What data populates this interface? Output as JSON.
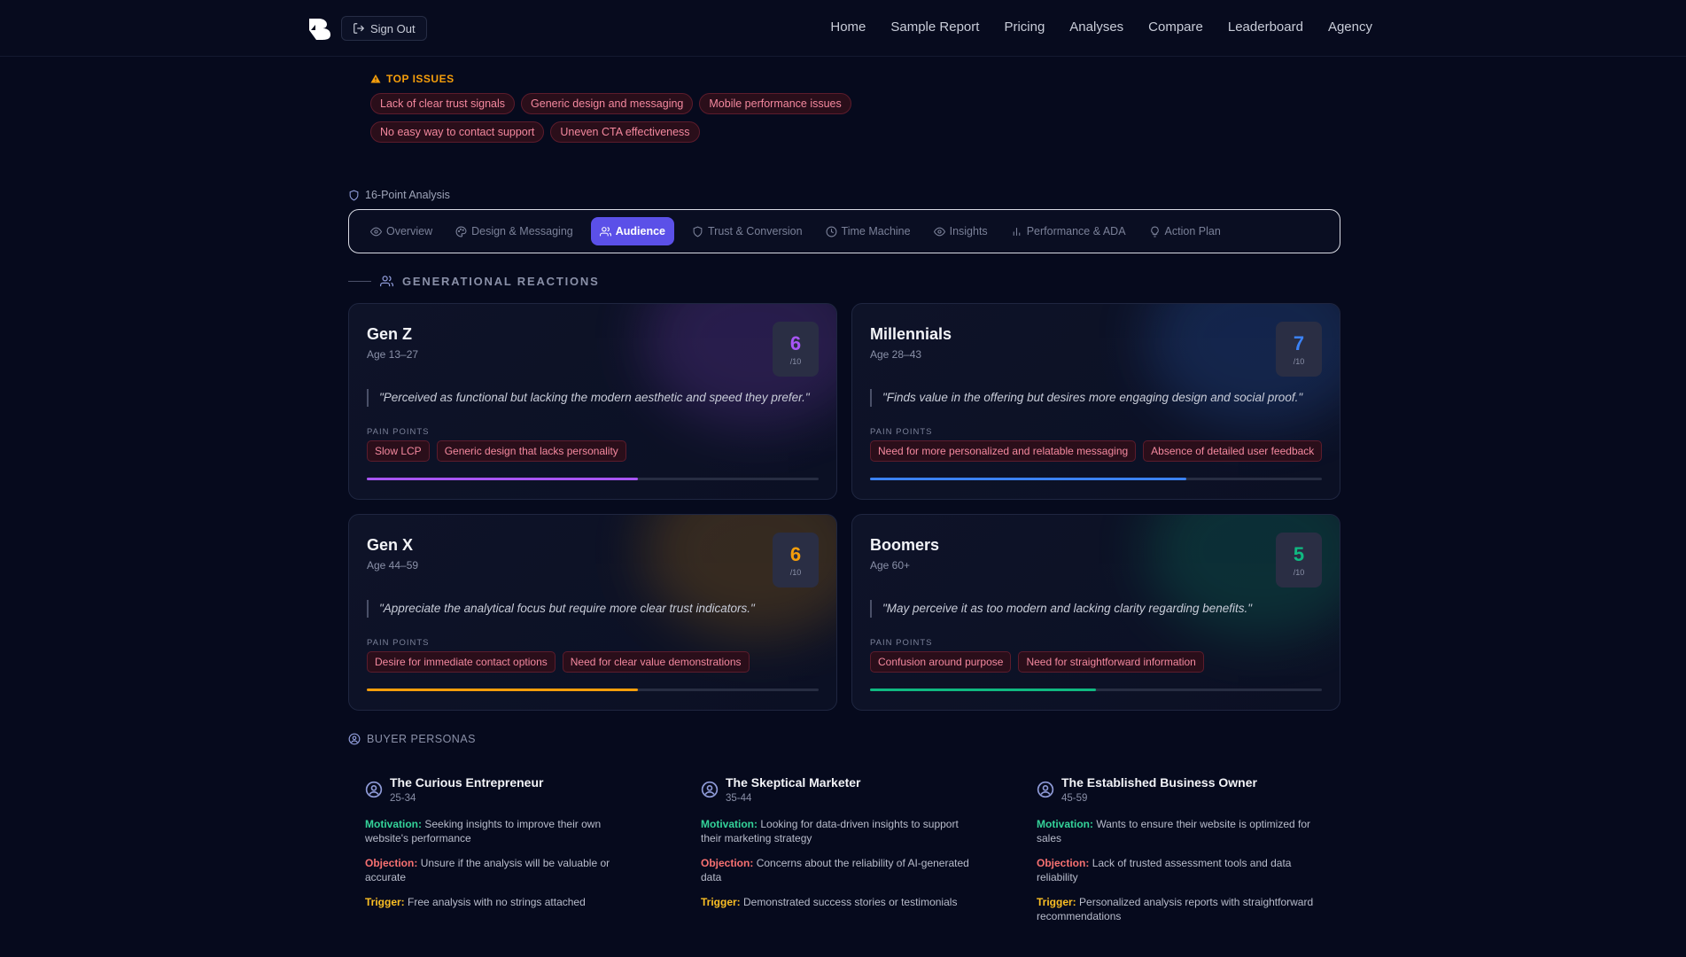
{
  "nav": {
    "signout_label": "Sign Out",
    "links": [
      "Home",
      "Sample Report",
      "Pricing",
      "Analyses",
      "Compare",
      "Leaderboard",
      "Agency"
    ]
  },
  "top_issues": {
    "title": "TOP ISSUES",
    "items": [
      "Lack of clear trust signals",
      "Generic design and messaging",
      "Mobile performance issues",
      "No easy way to contact support",
      "Uneven CTA effectiveness"
    ]
  },
  "analysis": {
    "label": "16-Point Analysis",
    "tabs": [
      {
        "label": "Overview",
        "icon": "eye-icon",
        "active": false
      },
      {
        "label": "Design & Messaging",
        "icon": "palette-icon",
        "active": false
      },
      {
        "label": "Audience",
        "icon": "users-icon",
        "active": true
      },
      {
        "label": "Trust & Conversion",
        "icon": "shield-icon",
        "active": false
      },
      {
        "label": "Time Machine",
        "icon": "clock-icon",
        "active": false
      },
      {
        "label": "Insights",
        "icon": "eye-icon",
        "active": false
      },
      {
        "label": "Performance & ADA",
        "icon": "bar-chart-icon",
        "active": false
      },
      {
        "label": "Action Plan",
        "icon": "lightbulb-icon",
        "active": false
      }
    ]
  },
  "generational": {
    "heading": "GENERATIONAL REACTIONS",
    "pain_points_label": "PAIN POINTS",
    "score_denominator": "/10",
    "cards": [
      {
        "name": "Gen Z",
        "age": "Age 13–27",
        "score": "6",
        "score_value": 6,
        "color": "#a855f7",
        "quote": "\"Perceived as functional but lacking the modern aesthetic and speed they prefer.\"",
        "pain_points": [
          "Slow LCP",
          "Generic design that lacks personality"
        ]
      },
      {
        "name": "Millennials",
        "age": "Age 28–43",
        "score": "7",
        "score_value": 7,
        "color": "#3b82f6",
        "quote": "\"Finds value in the offering but desires more engaging design and social proof.\"",
        "pain_points": [
          "Need for more personalized and relatable messaging",
          "Absence of detailed user feedback"
        ]
      },
      {
        "name": "Gen X",
        "age": "Age 44–59",
        "score": "6",
        "score_value": 6,
        "color": "#f59e0b",
        "quote": "\"Appreciate the analytical focus but require more clear trust indicators.\"",
        "pain_points": [
          "Desire for immediate contact options",
          "Need for clear value demonstrations"
        ]
      },
      {
        "name": "Boomers",
        "age": "Age 60+",
        "score": "5",
        "score_value": 5,
        "color": "#10b981",
        "quote": "\"May perceive it as too modern and lacking clarity regarding benefits.\"",
        "pain_points": [
          "Confusion around purpose",
          "Need for straightforward information"
        ]
      }
    ]
  },
  "buyer_personas": {
    "heading": "BUYER PERSONAS",
    "labels": {
      "motivation": "Motivation:",
      "objection": "Objection:",
      "trigger": "Trigger:"
    },
    "colors": {
      "motivation": "#34d399",
      "objection": "#f87171",
      "trigger": "#fbbf24"
    },
    "items": [
      {
        "name": "The Curious Entrepreneur",
        "age": "25-34",
        "motivation": "Seeking insights to improve their own website's performance",
        "objection": "Unsure if the analysis will be valuable or accurate",
        "trigger": "Free analysis with no strings attached"
      },
      {
        "name": "The Skeptical Marketer",
        "age": "35-44",
        "motivation": "Looking for data-driven insights to support their marketing strategy",
        "objection": "Concerns about the reliability of AI-generated data",
        "trigger": "Demonstrated success stories or testimonials"
      },
      {
        "name": "The Established Business Owner",
        "age": "45-59",
        "motivation": "Wants to ensure their website is optimized for sales",
        "objection": "Lack of trusted assessment tools and data reliability",
        "trigger": "Personalized analysis reports with straightforward recommendations"
      }
    ]
  }
}
